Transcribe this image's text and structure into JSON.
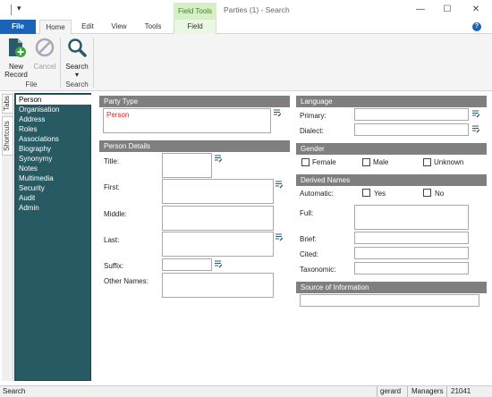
{
  "window": {
    "title": "Parties (1) - Search",
    "context_group": "Field Tools",
    "controls": {
      "minimize": "—",
      "maximize": "☐",
      "close": "✕"
    }
  },
  "qat": {
    "arrow": "▾"
  },
  "tabs": {
    "file": "File",
    "home": "Home",
    "edit": "Edit",
    "view": "View",
    "tools": "Tools",
    "field": "Field"
  },
  "help": "?",
  "ribbon": {
    "new_record": [
      "New",
      "Record"
    ],
    "cancel": "Cancel",
    "search": "Search",
    "search_arrow": "▾",
    "group_file": "File",
    "group_search": "Search"
  },
  "side_tabs": {
    "tabs": "Tabs",
    "shortcuts": "Shortcuts"
  },
  "nav": {
    "items": [
      "Person",
      "Organisation",
      "Address",
      "Roles",
      "Associations",
      "Biography",
      "Synonymy",
      "Notes",
      "Multimedia",
      "Security",
      "Audit",
      "Admin"
    ],
    "selected": 0
  },
  "party_type": {
    "header": "Party Type",
    "value": "Person",
    "value_color": "#e0201a"
  },
  "person_details": {
    "header": "Person Details",
    "title_label": "Title:",
    "first_label": "First:",
    "middle_label": "Middle:",
    "last_label": "Last:",
    "suffix_label": "Suffix:",
    "other_names_label": "Other Names:"
  },
  "language": {
    "header": "Language",
    "primary_label": "Primary:",
    "dialect_label": "Dialect:"
  },
  "gender": {
    "header": "Gender",
    "options": [
      "Female",
      "Male",
      "Unknown"
    ]
  },
  "derived_names": {
    "header": "Derived Names",
    "automatic_label": "Automatic:",
    "yes": "Yes",
    "no": "No",
    "full_label": "Full:",
    "brief_label": "Brief:",
    "cited_label": "Cited:",
    "taxonomic_label": "Taxonomic:"
  },
  "source": {
    "header": "Source of Information"
  },
  "status": {
    "left": "Search",
    "user": "gerard",
    "group": "Managers",
    "count": "21041"
  },
  "icons": {
    "new_record": "document-plus-icon",
    "cancel": "no-entry-icon",
    "search": "magnifier-icon",
    "notes": "notes-edit-icon"
  },
  "colors": {
    "file_tab": "#1a63b9",
    "nav_bg": "#285a63",
    "section_header": "#7f7f7f",
    "context_tab": "#d4f0c4"
  }
}
